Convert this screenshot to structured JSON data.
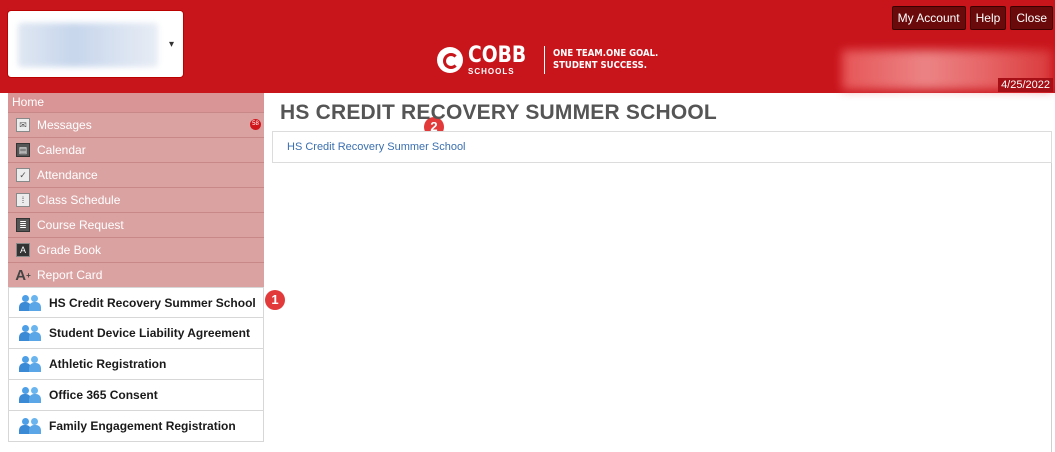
{
  "header": {
    "logo": {
      "word": "COBB",
      "sub": "SCHOOLS",
      "tagline_1": "ONE TEAM.ONE GOAL.",
      "tagline_2": "STUDENT SUCCESS."
    },
    "buttons": [
      "My Account",
      "Help",
      "Close"
    ],
    "date": "4/25/2022",
    "student_select_caret": "▾"
  },
  "sidebar": {
    "home": "Home",
    "menu": [
      {
        "label": "Messages",
        "icon": "envelope-icon",
        "badge": "58"
      },
      {
        "label": "Calendar",
        "icon": "calendar-icon"
      },
      {
        "label": "Attendance",
        "icon": "checkbox-icon"
      },
      {
        "label": "Class Schedule",
        "icon": "schedule-icon"
      },
      {
        "label": "Course Request",
        "icon": "course-request-icon"
      },
      {
        "label": "Grade Book",
        "icon": "grade-book-icon"
      },
      {
        "label": "Report Card",
        "icon": "report-card-icon"
      }
    ],
    "forms": [
      "HS Credit Recovery Summer School",
      "Student Device Liability Agreement",
      "Athletic Registration",
      "Office 365 Consent",
      "Family Engagement Registration"
    ]
  },
  "markers": [
    "1",
    "2"
  ],
  "main": {
    "title": "HS CREDIT RECOVERY SUMMER SCHOOL",
    "link": "HS Credit Recovery Summer School"
  },
  "colors": {
    "header_red": "#c8141b",
    "sidebar_pink": "#dba2a2",
    "link_blue": "#3a6fb0",
    "icon_blue": "#3a8ad6"
  }
}
